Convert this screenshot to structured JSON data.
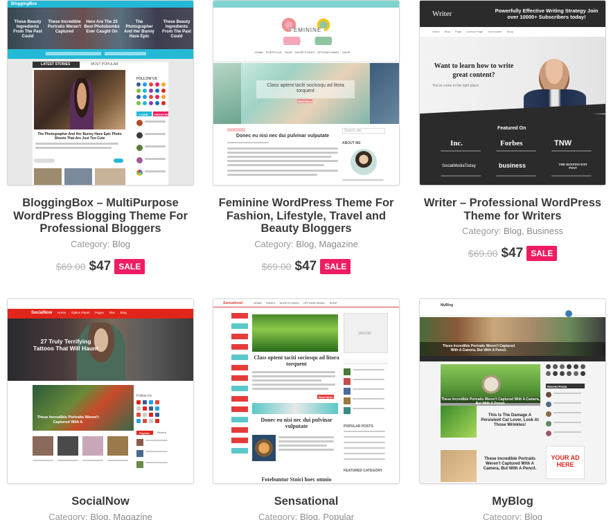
{
  "products": [
    {
      "title": "BloggingBox – MultiPurpose WordPress Blogging Theme For Professional Bloggers",
      "category_label": "Category:",
      "categories": "Blog",
      "old_price": "$69.00",
      "new_price": "$47",
      "badge": "SALE",
      "preview": {
        "logo": "BloggingBox",
        "slides": [
          "These Beauty Ingredients From The Past Could",
          "These Incredible Portraits Weren't Captured",
          "Here Are The 25 Best Photobombs Ever Caught On",
          "The Photographer And Her Bunny Have Epic",
          "These Beauty Ingredients From The Past Could"
        ],
        "tabs": [
          "LATEST STORIES",
          "MOST POPULAR"
        ],
        "headline": "The Photographer And Her Bunny Have Epic Photo Shoots That Are Just Too Cute",
        "follow": "FOLLOW US",
        "login": "LOGIN",
        "register": "REGISTER"
      }
    },
    {
      "title": "Feminine WordPress Theme For Fashion, Lifestyle, Travel and Beauty Bloggers",
      "category_label": "Category:",
      "categories": "Blog, Magazine",
      "old_price": "$69.00",
      "new_price": "$47",
      "badge": "SALE",
      "preview": {
        "logo": "FEMININE",
        "nav": [
          "HOME",
          "PORTFOLIO",
          "PAGE",
          "SHORTCODES",
          "OPTIONS PANEL",
          "SHOP"
        ],
        "slide_title": "Class aptent taciti sociosqu ad litora torquent",
        "read_more": "Read More",
        "post_title": "Donec eu nisi nec dui pulvinar vulputate",
        "about": "ABOUT ME",
        "search": "Search site"
      }
    },
    {
      "title": "Writer – Professional WordPress Theme for Writers",
      "category_label": "Category:",
      "categories": "Blog, Business",
      "old_price": "$69.00",
      "new_price": "$47",
      "badge": "SALE",
      "preview": {
        "logo": "Writer",
        "promo": "Powerfully Effective Writing Strategy Join over 10000+ Subscribers today!",
        "nav": [
          "Home",
          "Blog",
          "Page",
          "Contact Page",
          "Shortcodes",
          "Shop"
        ],
        "hero": "Want to learn how to write great content?",
        "hero_sub": "You've come to the right place.",
        "featured": "Featured On",
        "brands": [
          "Inc.",
          "Forbes",
          "TNW",
          "SocialMediaToday",
          "business",
          "THE HUFFINGTON POST"
        ]
      }
    },
    {
      "title": "SocialNow",
      "category_label": "Category:",
      "categories": "Blog, Magazine",
      "preview": {
        "logo": "SocialNow",
        "nav": [
          "Home",
          "Option Panel",
          "Pages",
          "Rtw",
          "Blog"
        ],
        "hero": "27 Truly Terrifying Tattoos That Will Haunt",
        "mid": "These Incredible Portraits Weren't Captured With A",
        "tabs": [
          "Popular",
          "Recent"
        ],
        "follow": "Follow Us"
      }
    },
    {
      "title": "Sensational",
      "category_label": "Category:",
      "categories": "Blog, Popular",
      "preview": {
        "logo": "Sensational",
        "nav": [
          "HOME",
          "PAGES",
          "SHORTCODES",
          "OPTIONS PANEL",
          "SHOP"
        ],
        "post1": "Class optent taciti sociosqu ad litora torquent",
        "post2": "Donec eu nisi nec dui pulvinar vulputate",
        "post3": "Fotebuntur Stoici hoec omnio",
        "ad": "300x250",
        "popular": "POPULAR POSTS",
        "featured": "FEATURED CATEGORY",
        "read_more": "Read More"
      }
    },
    {
      "title": "MyBlog",
      "category_label": "Category:",
      "categories": "Blog",
      "preview": {
        "logo": "MyBlog",
        "slider": "These Incredible Portraits Weren't Captured With A Camera, But With A Pencil.",
        "post1": "These Incredible Portraits Weren't Captured With A Camera, But With A Pencil.",
        "post2": "This Is The Damage A Persistent Cat Lover, Look At Those Wrinkles!",
        "ad": "YOUR AD HERE",
        "recent": "Recent Posts"
      }
    }
  ],
  "colors": {
    "sale": "#ee1c63",
    "bloggingbox_header": "#23b9d6",
    "feminine_accent": "#f08d8d",
    "writer_dark": "#2b2b2b",
    "socialnow_red": "#e1251b",
    "sensational_red": "#e63b3b"
  }
}
